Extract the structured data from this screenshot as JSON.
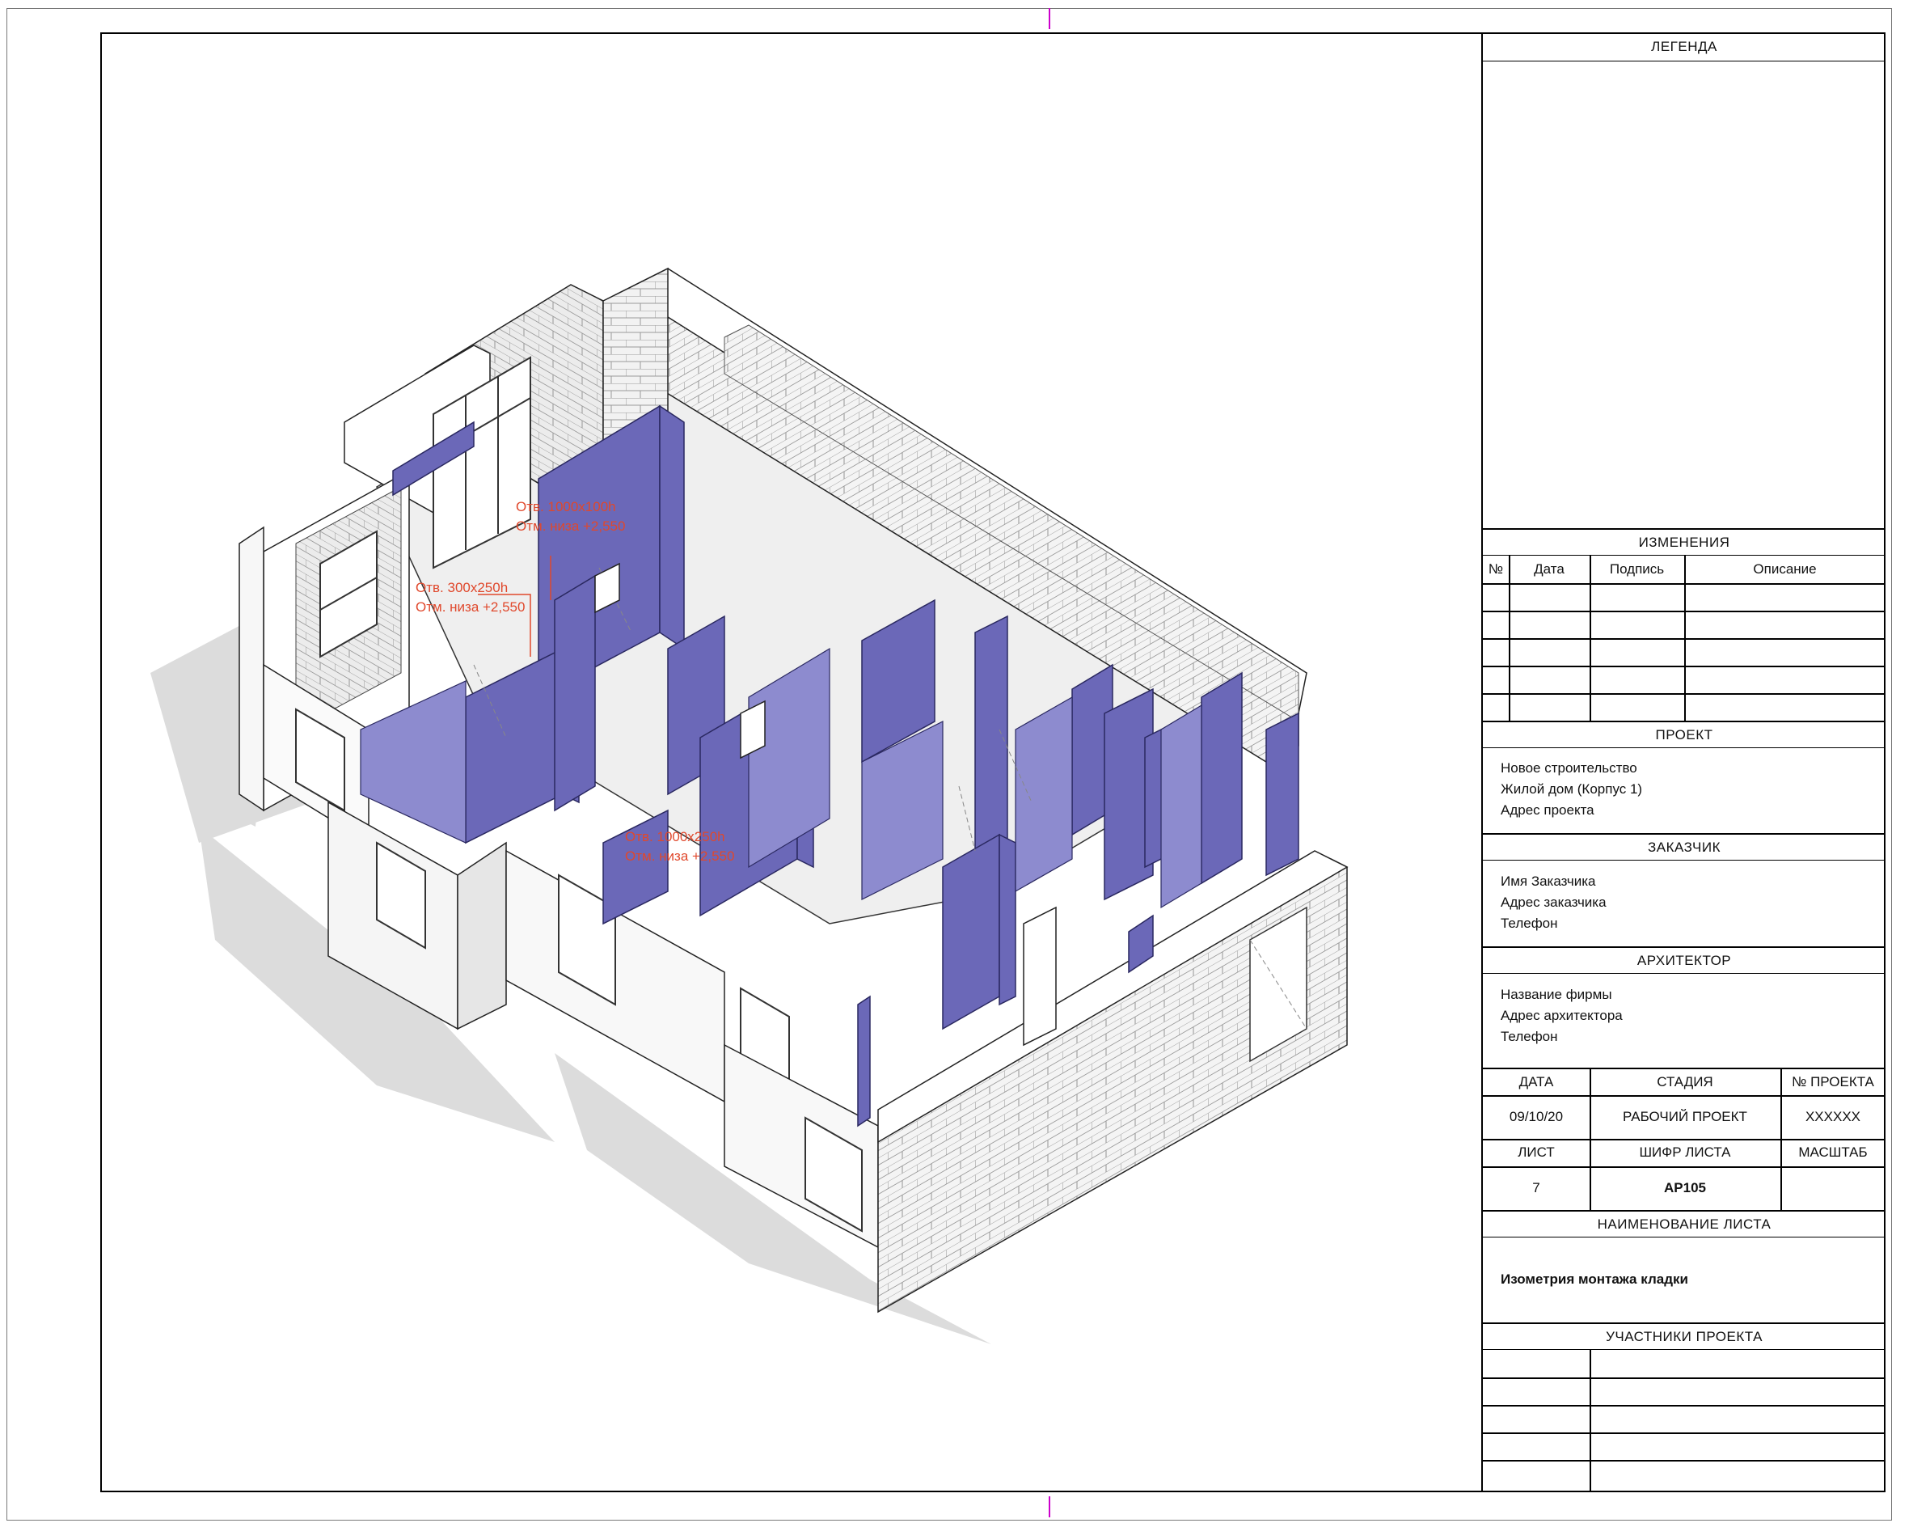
{
  "drawing": {
    "annotations": [
      {
        "line1": "Отв. 1000x100h",
        "line2": "Отм. низа +2,550"
      },
      {
        "line1": "Отв. 300x250h",
        "line2": "Отм. низа +2,550"
      },
      {
        "line1": "Отв. 1000x250h",
        "line2": "Отм. низа +2,550"
      }
    ],
    "colors": {
      "wall_new": "#6b68b8",
      "wall_existing": "#e8e8e8",
      "annotation": "#e0482c"
    }
  },
  "title_block": {
    "legend_title": "ЛЕГЕНДА",
    "changes_title": "ИЗМЕНЕНИЯ",
    "changes_columns": [
      "№",
      "Дата",
      "Подпись",
      "Описание"
    ],
    "project_title": "ПРОЕКТ",
    "project_lines": [
      "Новое строительство",
      "Жилой дом (Корпус 1)",
      "Адрес проекта"
    ],
    "client_title": "ЗАКАЗЧИК",
    "client_lines": [
      "Имя Заказчика",
      "Адрес заказчика",
      "Телефон"
    ],
    "architect_title": "АРХИТЕКТОР",
    "architect_lines": [
      "Название фирмы",
      "Адрес архитектора",
      "Телефон"
    ],
    "date_label": "ДАТА",
    "stage_label": "СТАДИЯ",
    "project_no_label": "№ ПРОЕКТА",
    "date_value": "09/10/20",
    "stage_value": "РАБОЧИЙ ПРОЕКТ",
    "project_no_value": "XXXXXX",
    "sheet_label": "ЛИСТ",
    "code_label": "ШИФР ЛИСТА",
    "scale_label": "МАСШТАБ",
    "sheet_value": "7",
    "code_value": "АР105",
    "scale_value": "",
    "sheet_name_title": "НАИМЕНОВАНИЕ ЛИСТА",
    "sheet_name_value": "Изометрия монтажа кладки",
    "participants_title": "УЧАСТНИКИ ПРОЕКТА"
  }
}
